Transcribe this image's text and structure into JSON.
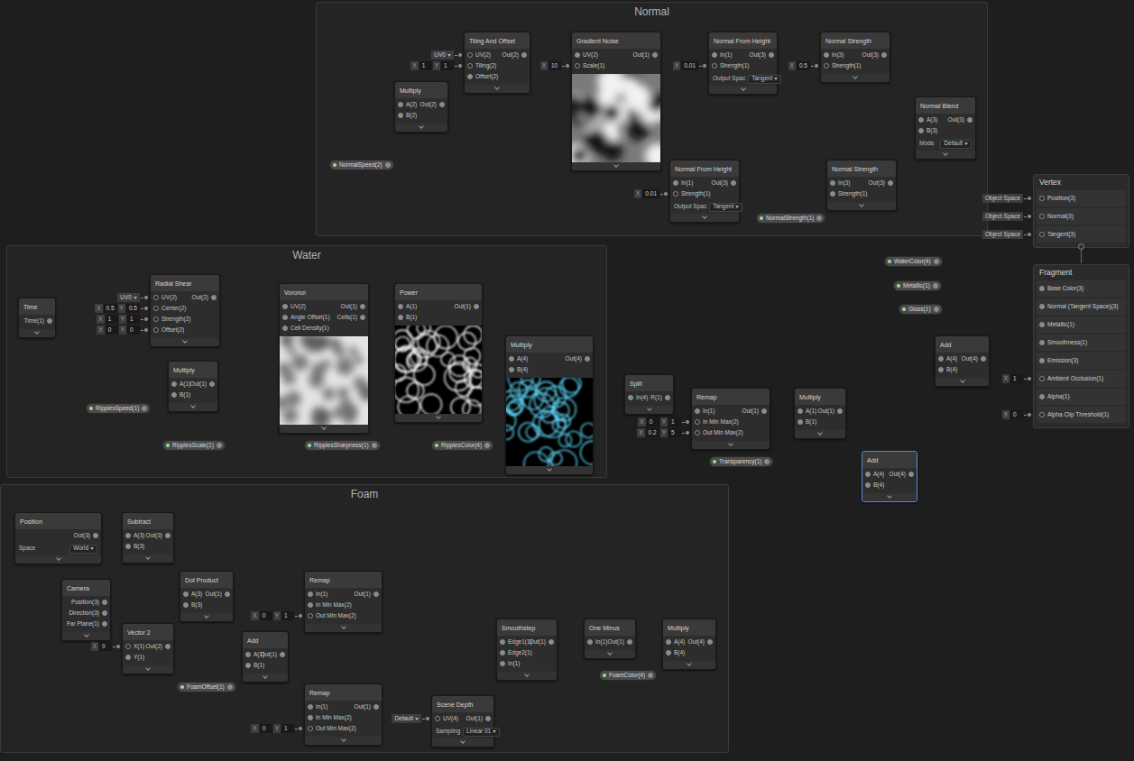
{
  "groups": [
    {
      "title": "Normal"
    },
    {
      "title": "Water"
    },
    {
      "title": "Foam"
    }
  ],
  "nodes": [
    {
      "title": "Tiling And Offset",
      "selected": false,
      "inputs": [
        {
          "label": "UV(2)",
          "field": {
            "kind": "dropdown",
            "value": "UV0"
          }
        },
        {
          "label": "Tiling(2)",
          "field": {
            "kind": "vector",
            "parts": [
              {
                "axis": "X",
                "value": "1"
              },
              {
                "axis": "Y",
                "value": "1"
              }
            ]
          }
        },
        {
          "label": "Offset(2)"
        }
      ],
      "outputs": [
        "Out(2)"
      ]
    },
    {
      "title": "Gradient Noise",
      "selected": false,
      "inputs": [
        {
          "label": "UV(2)"
        },
        {
          "label": "Scale(1)",
          "field": {
            "kind": "vector",
            "parts": [
              {
                "axis": "X",
                "value": "10"
              }
            ]
          }
        }
      ],
      "outputs": [
        "Out(1)"
      ],
      "preview": "noise"
    },
    {
      "title": "Normal From Height",
      "selected": false,
      "inputs": [
        {
          "label": "In(1)"
        },
        {
          "label": "Strength(1)",
          "field": {
            "kind": "vector",
            "parts": [
              {
                "axis": "X",
                "value": "0.01"
              }
            ]
          }
        }
      ],
      "outputs": [
        "Out(3)"
      ],
      "options": [
        {
          "label": "Output Spac",
          "value": "Tangent"
        }
      ]
    },
    {
      "title": "Normal Strength",
      "selected": false,
      "inputs": [
        {
          "label": "In(3)"
        },
        {
          "label": "Strength(1)",
          "field": {
            "kind": "vector",
            "parts": [
              {
                "axis": "X",
                "value": "0.5"
              }
            ]
          }
        }
      ],
      "outputs": [
        "Out(3)"
      ]
    },
    {
      "title": "Normal Blend",
      "selected": false,
      "inputs": [
        {
          "label": "A(3)"
        },
        {
          "label": "B(3)"
        }
      ],
      "outputs": [
        "Out(3)"
      ],
      "options": [
        {
          "label": "Mode",
          "value": "Default"
        }
      ]
    },
    {
      "title": "Normal From Height",
      "selected": false,
      "inputs": [
        {
          "label": "In(1)"
        },
        {
          "label": "Strength(1)",
          "field": {
            "kind": "vector",
            "parts": [
              {
                "axis": "X",
                "value": "0.01"
              }
            ]
          }
        }
      ],
      "outputs": [
        "Out(3)"
      ],
      "options": [
        {
          "label": "Output Spac",
          "value": "Tangent"
        }
      ]
    },
    {
      "title": "Normal Strength",
      "selected": false,
      "inputs": [
        {
          "label": "In(3)"
        },
        {
          "label": "Strength(1)"
        }
      ],
      "outputs": [
        "Out(3)"
      ]
    },
    {
      "title": "Multiply",
      "selected": false,
      "inputs": [
        {
          "label": "A(2)"
        },
        {
          "label": "B(2)"
        }
      ],
      "outputs": [
        "Out(2)"
      ]
    },
    {
      "title": "Time",
      "selected": false,
      "inputs": [],
      "outputs": [
        "Time(1)"
      ]
    },
    {
      "title": "Radial Shear",
      "selected": false,
      "inputs": [
        {
          "label": "UV(2)",
          "field": {
            "kind": "dropdown",
            "value": "UV0"
          }
        },
        {
          "label": "Center(2)",
          "field": {
            "kind": "vector",
            "parts": [
              {
                "axis": "X",
                "value": "0.5"
              },
              {
                "axis": "Y",
                "value": "0.5"
              }
            ]
          }
        },
        {
          "label": "Strength(2)",
          "field": {
            "kind": "vector",
            "parts": [
              {
                "axis": "X",
                "value": "1"
              },
              {
                "axis": "Y",
                "value": "1"
              }
            ]
          }
        },
        {
          "label": "Offset(2)",
          "field": {
            "kind": "vector",
            "parts": [
              {
                "axis": "X",
                "value": "0"
              },
              {
                "axis": "Y",
                "value": "0"
              }
            ]
          }
        }
      ],
      "outputs": [
        "Out(2)"
      ]
    },
    {
      "title": "Multiply",
      "selected": false,
      "inputs": [
        {
          "label": "A(1)"
        },
        {
          "label": "B(1)"
        }
      ],
      "outputs": [
        "Out(1)"
      ]
    },
    {
      "title": "Voronoi",
      "selected": false,
      "inputs": [
        {
          "label": "UV(2)"
        },
        {
          "label": "Angle Offset(1)"
        },
        {
          "label": "Cell Density(1)"
        }
      ],
      "outputs": [
        "Out(1)",
        "Cells(1)"
      ],
      "preview": "cells"
    },
    {
      "title": "Power",
      "selected": false,
      "inputs": [
        {
          "label": "A(1)"
        },
        {
          "label": "B(1)"
        }
      ],
      "outputs": [
        "Out(1)"
      ],
      "preview": "ridges"
    },
    {
      "title": "Multiply",
      "selected": false,
      "inputs": [
        {
          "label": "A(4)"
        },
        {
          "label": "B(4)"
        }
      ],
      "outputs": [
        "Out(4)"
      ],
      "preview": "tinted"
    },
    {
      "title": "Split",
      "selected": false,
      "inputs": [
        {
          "label": "In(4)"
        }
      ],
      "outputs": [
        "R(1)"
      ]
    },
    {
      "title": "Remap",
      "selected": false,
      "inputs": [
        {
          "label": "In(1)"
        },
        {
          "label": "In Min Max(2)",
          "field": {
            "kind": "vector",
            "parts": [
              {
                "axis": "X",
                "value": "0"
              },
              {
                "axis": "Y",
                "value": "1"
              }
            ]
          }
        },
        {
          "label": "Out Min Max(2)",
          "field": {
            "kind": "vector",
            "parts": [
              {
                "axis": "X",
                "value": "0.2"
              },
              {
                "axis": "Y",
                "value": "5"
              }
            ]
          }
        }
      ],
      "outputs": [
        "Out(1)"
      ]
    },
    {
      "title": "Multiply",
      "selected": false,
      "inputs": [
        {
          "label": "A(1)"
        },
        {
          "label": "B(1)"
        }
      ],
      "outputs": [
        "Out(1)"
      ]
    },
    {
      "title": "Add",
      "selected": true,
      "inputs": [
        {
          "label": "A(4)"
        },
        {
          "label": "B(4)"
        }
      ],
      "outputs": [
        "Out(4)"
      ]
    },
    {
      "title": "Add",
      "selected": false,
      "inputs": [
        {
          "label": "A(4)"
        },
        {
          "label": "B(4)"
        }
      ],
      "outputs": [
        "Out(4)"
      ]
    },
    {
      "title": "Position",
      "selected": false,
      "inputs": [],
      "outputs": [
        "Out(3)"
      ],
      "options": [
        {
          "label": "Space",
          "value": "World"
        }
      ]
    },
    {
      "title": "Subtract",
      "selected": false,
      "inputs": [
        {
          "label": "A(3)"
        },
        {
          "label": "B(3)"
        }
      ],
      "outputs": [
        "Out(3)"
      ]
    },
    {
      "title": "Camera",
      "selected": false,
      "inputs": [],
      "outputs": [
        "Position(3)",
        "Direction(3)",
        "Far Plane(1)"
      ]
    },
    {
      "title": "Dot Product",
      "selected": false,
      "inputs": [
        {
          "label": "A(3)"
        },
        {
          "label": "B(3)"
        }
      ],
      "outputs": [
        "Out(1)"
      ]
    },
    {
      "title": "Vector 2",
      "selected": false,
      "inputs": [
        {
          "label": "X(1)",
          "field": {
            "kind": "vector",
            "parts": [
              {
                "axis": "X",
                "value": "0"
              }
            ]
          }
        },
        {
          "label": "Y(1)"
        }
      ],
      "outputs": [
        "Out(2)"
      ]
    },
    {
      "title": "Add",
      "selected": false,
      "inputs": [
        {
          "label": "A(1)"
        },
        {
          "label": "B(1)"
        }
      ],
      "outputs": [
        "Out(1)"
      ]
    },
    {
      "title": "Remap",
      "selected": false,
      "inputs": [
        {
          "label": "In(1)"
        },
        {
          "label": "In Min Max(2)"
        },
        {
          "label": "Out Min Max(2)",
          "field": {
            "kind": "vector",
            "parts": [
              {
                "axis": "X",
                "value": "0"
              },
              {
                "axis": "Y",
                "value": "1"
              }
            ]
          }
        }
      ],
      "outputs": [
        "Out(1)"
      ]
    },
    {
      "title": "Remap",
      "selected": false,
      "inputs": [
        {
          "label": "In(1)"
        },
        {
          "label": "In Min Max(2)"
        },
        {
          "label": "Out Min Max(2)",
          "field": {
            "kind": "vector",
            "parts": [
              {
                "axis": "X",
                "value": "0"
              },
              {
                "axis": "Y",
                "value": "1"
              }
            ]
          }
        }
      ],
      "outputs": [
        "Out(1)"
      ]
    },
    {
      "title": "Scene Depth",
      "selected": false,
      "inputs": [
        {
          "label": "UV(4)",
          "field": {
            "kind": "dropdown",
            "value": "Default"
          }
        }
      ],
      "outputs": [
        "Out(1)"
      ],
      "options": [
        {
          "label": "Sampling",
          "value": "Linear 01"
        }
      ]
    },
    {
      "title": "Smoothstep",
      "selected": false,
      "inputs": [
        {
          "label": "Edge1(1)"
        },
        {
          "label": "Edge2(1)"
        },
        {
          "label": "In(1)"
        }
      ],
      "outputs": [
        "Out(1)"
      ]
    },
    {
      "title": "One Minus",
      "selected": false,
      "inputs": [
        {
          "label": "In(1)"
        }
      ],
      "outputs": [
        "Out(1)"
      ]
    },
    {
      "title": "Multiply",
      "selected": false,
      "inputs": [
        {
          "label": "A(4)"
        },
        {
          "label": "B(4)"
        }
      ],
      "outputs": [
        "Out(4)"
      ]
    }
  ],
  "properties": [
    {
      "label": "NormalSpeed(2)"
    },
    {
      "label": "NormalStrength(1)"
    },
    {
      "label": "RipplesSpeed(1)"
    },
    {
      "label": "RipplesScale(1)"
    },
    {
      "label": "RipplesSharpness(1)"
    },
    {
      "label": "RipplesColor(4)"
    },
    {
      "label": "Transparency(1)"
    },
    {
      "label": "WaterColor(4)"
    },
    {
      "label": "Metallic(1)"
    },
    {
      "label": "Gloss(1)"
    },
    {
      "label": "FoamOffset(1)"
    },
    {
      "label": "FoamColor(4)"
    }
  ],
  "master": {
    "vertex": {
      "title": "Vertex",
      "ports": [
        {
          "label": "Position(3)",
          "field": {
            "kind": "space",
            "value": "Object Space"
          }
        },
        {
          "label": "Normal(3)",
          "field": {
            "kind": "space",
            "value": "Object Space"
          }
        },
        {
          "label": "Tangent(3)",
          "field": {
            "kind": "space",
            "value": "Object Space"
          }
        }
      ]
    },
    "fragment": {
      "title": "Fragment",
      "ports": [
        {
          "label": "Base Color(3)"
        },
        {
          "label": "Normal (Tangent Space)(3)"
        },
        {
          "label": "Metallic(1)"
        },
        {
          "label": "Smoothness(1)"
        },
        {
          "label": "Emission(3)"
        },
        {
          "label": "Ambient Occlusion(1)",
          "field": {
            "kind": "vector",
            "parts": [
              {
                "axis": "X",
                "value": "1"
              }
            ]
          }
        },
        {
          "label": "Alpha(1)"
        },
        {
          "label": "Alpha Clip Threshold(1)",
          "field": {
            "kind": "vector",
            "parts": [
              {
                "axis": "X",
                "value": "0"
              }
            ]
          }
        }
      ]
    }
  }
}
